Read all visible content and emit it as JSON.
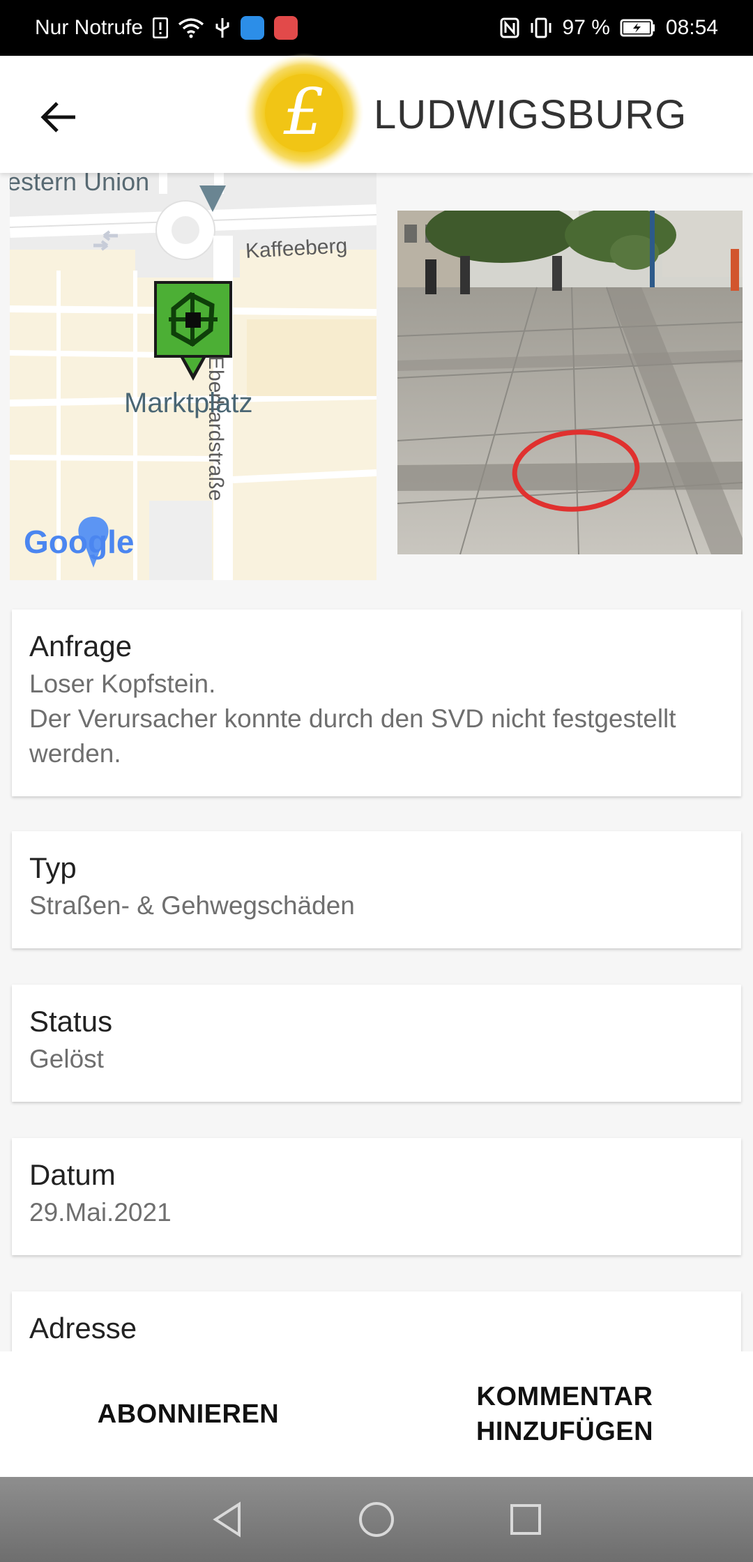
{
  "status_bar": {
    "carrier": "Nur Notrufe",
    "battery": "97 %",
    "time": "08:54"
  },
  "header": {
    "logo_letter": "£",
    "logo_text": "LUDWIGSBURG"
  },
  "map": {
    "labels": {
      "top_partial": "estern Union",
      "street_1": "Kaffeeberg",
      "street_2": "Eberhardstraße",
      "place": "Marktplatz",
      "attribution": "Google"
    }
  },
  "cards": [
    {
      "title": "Anfrage",
      "value": "Loser Kopfstein.\nDer Verursacher konnte durch den SVD nicht festgestellt werden."
    },
    {
      "title": "Typ",
      "value": "Straßen- & Gehwegschäden"
    },
    {
      "title": "Status",
      "value": "Gelöst"
    },
    {
      "title": "Datum",
      "value": "29.Mai.2021"
    },
    {
      "title": "Adresse",
      "value": ""
    }
  ],
  "actions": {
    "subscribe": "ABONNIEREN",
    "comment": "KOMMENTAR\nHINZUFÜGEN"
  },
  "colors": {
    "marker_green": "#4caf35",
    "logo_yellow": "#f2cc1c",
    "photo_circle": "#e0312f"
  }
}
